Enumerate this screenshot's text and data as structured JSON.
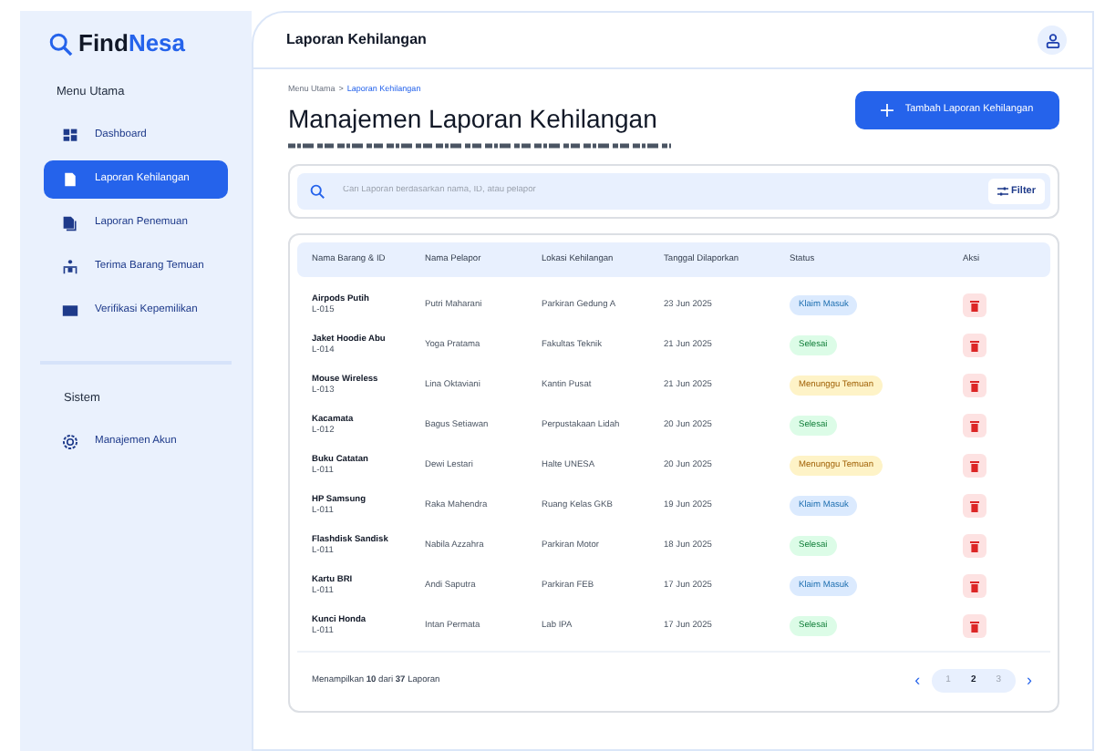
{
  "brand": {
    "part_1": "Find",
    "part_2": "Nesa"
  },
  "sidebar": {
    "sections": [
      {
        "title": "Menu Utama",
        "items": [
          {
            "label": "Dashboard",
            "kind": "dashboard",
            "selected": false
          },
          {
            "label": "Laporan Kehilangan",
            "kind": "doc",
            "selected": true
          },
          {
            "label": "Laporan Penemuan",
            "kind": "docs",
            "selected": false
          },
          {
            "label": "Terima Barang Temuan",
            "kind": "hands",
            "selected": false
          },
          {
            "label": "Verifikasi Kepemilikan",
            "kind": "card",
            "selected": false
          }
        ]
      },
      {
        "title": "Sistem",
        "items": [
          {
            "label": "Manajemen Akun",
            "kind": "gear",
            "selected": false
          }
        ]
      }
    ]
  },
  "header": {
    "title": "Laporan Kehilangan"
  },
  "breadcrumb": {
    "root": "Menu Utama",
    "separator": ">",
    "current": "Laporan Kehilangan"
  },
  "page": {
    "title": "Manajemen Laporan Kehilangan",
    "add_button": "Tambah Laporan Kehilangan"
  },
  "search": {
    "placeholder": "Cari Laporan berdasarkan nama, ID, atau pelapor",
    "filter_button": "Filter"
  },
  "table": {
    "columns": [
      "Nama Barang & ID",
      "Nama Pelapor",
      "Lokasi Kehilangan",
      "Tanggal Dilaporkan",
      "Status",
      "Aksi"
    ],
    "rows": [
      {
        "item": "Airpods Putih",
        "id": "L-015",
        "reporter": "Putri Maharani",
        "location": "Parkiran Gedung A",
        "date": "23 Jun 2025",
        "status": "Klaim Masuk",
        "color": "#dbeafe"
      },
      {
        "item": "Jaket Hoodie Abu",
        "id": "L-014",
        "reporter": "Yoga Pratama",
        "location": "Fakultas Teknik",
        "date": "21 Jun 2025",
        "status": "Selesai",
        "color": "#dcfce7"
      },
      {
        "item": "Mouse Wireless",
        "id": "L-013",
        "reporter": "Lina Oktaviani",
        "location": "Kantin Pusat",
        "date": "21 Jun 2025",
        "status": "Menunggu Temuan",
        "color": "#fef3c7"
      },
      {
        "item": "Kacamata",
        "id": "L-012",
        "reporter": "Bagus Setiawan",
        "location": "Perpustakaan Lidah",
        "date": "20 Jun 2025",
        "status": "Selesai",
        "color": "#dcfce7"
      },
      {
        "item": "Buku Catatan",
        "id": "L-011",
        "reporter": "Dewi Lestari",
        "location": "Halte UNESA",
        "date": "20 Jun 2025",
        "status": "Menunggu Temuan",
        "color": "#fef3c7"
      },
      {
        "item": "HP Samsung",
        "id": "L-011",
        "reporter": "Raka Mahendra",
        "location": "Ruang Kelas GKB",
        "date": "19 Jun 2025",
        "status": "Klaim Masuk",
        "color": "#dbeafe"
      },
      {
        "item": "Flashdisk Sandisk",
        "id": "L-011",
        "reporter": "Nabila Azzahra",
        "location": "Parkiran Motor",
        "date": "18 Jun 2025",
        "status": "Selesai",
        "color": "#dcfce7"
      },
      {
        "item": "Kartu BRI",
        "id": "L-011",
        "reporter": "Andi Saputra",
        "location": "Parkiran FEB",
        "date": "17 Jun 2025",
        "status": "Klaim Masuk",
        "color": "#dbeafe"
      },
      {
        "item": "Kunci Honda",
        "id": "L-011",
        "reporter": "Intan Permata",
        "location": "Lab IPA",
        "date": "17 Jun 2025",
        "status": "Selesai",
        "color": "#dcfce7"
      }
    ]
  },
  "footer": {
    "summary": "Menampilkan **10** dari **37** Laporan",
    "pages": [
      {
        "label": "1",
        "selected": false
      },
      {
        "label": "2",
        "selected": true
      },
      {
        "label": "3",
        "selected": false
      }
    ],
    "prev": "‹",
    "next": "›"
  }
}
